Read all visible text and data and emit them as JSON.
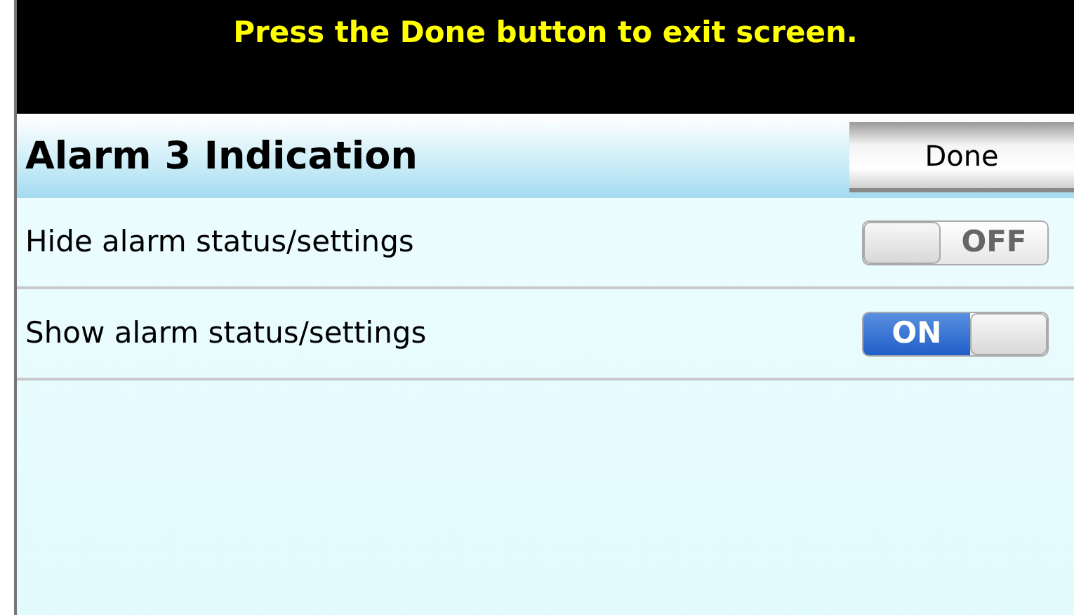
{
  "banner": {
    "text": "Press the Done button to exit screen."
  },
  "header": {
    "title": "Alarm 3 Indication",
    "done_button": "Done"
  },
  "options": [
    {
      "label": "Hide alarm status/settings",
      "on": false,
      "switch_text": "OFF"
    },
    {
      "label": "Show alarm status/settings",
      "on": true,
      "switch_text": "ON"
    }
  ]
}
